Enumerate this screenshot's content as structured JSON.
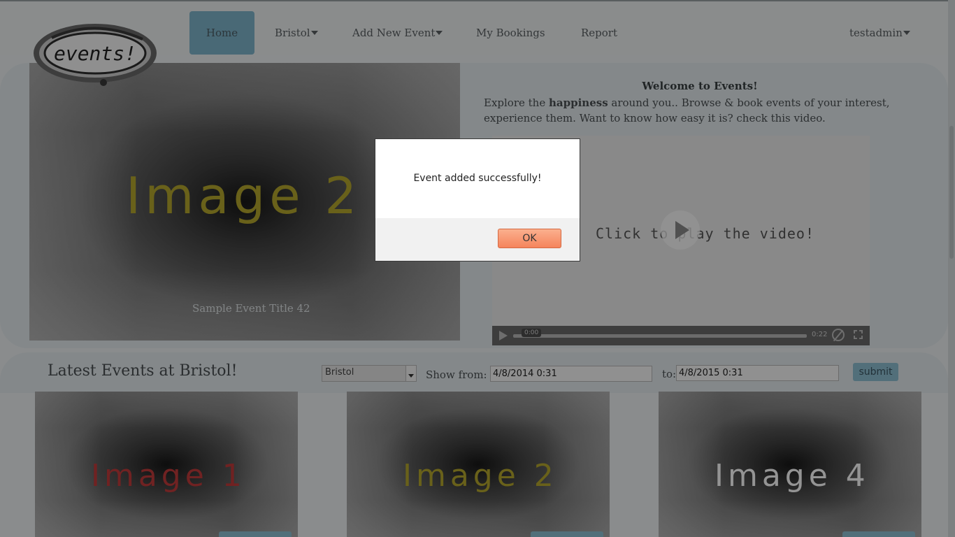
{
  "nav": {
    "home": "Home",
    "city": "Bristol",
    "add_event": "Add New Event",
    "my_bookings": "My Bookings",
    "report": "Report",
    "user": "testadmin"
  },
  "logo_text": "events!",
  "hero": {
    "image_label": "Image 2",
    "image_color": "#b5a72e",
    "caption": "Sample Event Title 42"
  },
  "welcome": {
    "title": "Welcome to Events!",
    "body_prefix": "Explore the ",
    "body_bold": "happiness",
    "body_suffix": " around you.. Browse & book events of your interest, experience them. Want to know how easy it is? check this video."
  },
  "video": {
    "cta": "Click to play the video!",
    "current_time": "0:00",
    "duration": "0:22"
  },
  "filter": {
    "title": "Latest Events at Bristol!",
    "city_value": "Bristol",
    "show_from_label": "Show from:",
    "from_value": "4/8/2014 0:31",
    "to_label": "to:",
    "to_value": "4/8/2015 0:31",
    "submit": "submit"
  },
  "cards": [
    {
      "label": "Image 1",
      "color": "#c23b3b"
    },
    {
      "label": "Image 2",
      "color": "#b5a72e"
    },
    {
      "label": "Image 4",
      "color": "#ffffff"
    }
  ],
  "dialog": {
    "message": "Event added successfully!",
    "ok": "OK"
  }
}
